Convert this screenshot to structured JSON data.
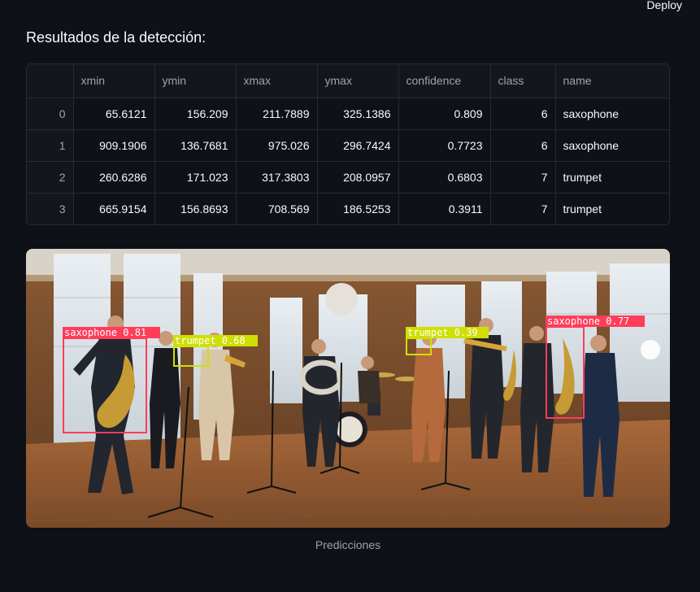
{
  "header": {
    "deploy_label": "Deploy"
  },
  "results": {
    "heading": "Resultados de la detección:",
    "columns": [
      "",
      "xmin",
      "ymin",
      "xmax",
      "ymax",
      "confidence",
      "class",
      "name"
    ],
    "rows": [
      [
        "0",
        "65.6121",
        "156.209",
        "211.7889",
        "325.1386",
        "0.809",
        "6",
        "saxophone"
      ],
      [
        "1",
        "909.1906",
        "136.7681",
        "975.026",
        "296.7424",
        "0.7723",
        "6",
        "saxophone"
      ],
      [
        "2",
        "260.6286",
        "171.023",
        "317.3803",
        "208.0957",
        "0.6803",
        "7",
        "trumpet"
      ],
      [
        "3",
        "665.9154",
        "156.8693",
        "708.569",
        "186.5253",
        "0.3911",
        "7",
        "trumpet"
      ]
    ]
  },
  "image": {
    "caption": "Predicciones",
    "detections": [
      {
        "label": "saxophone 0.81",
        "color": "#ff3d5a"
      },
      {
        "label": "trumpet 0.68",
        "color": "#cfe000"
      },
      {
        "label": "trumpet 0.39",
        "color": "#cfe000"
      },
      {
        "label": "saxophone 0.77",
        "color": "#ff3d5a"
      }
    ]
  },
  "colors": {
    "background": "#0e1117",
    "border": "#262a33",
    "muted_text": "#9fa3ad",
    "saxophone_box": "#ff3d5a",
    "trumpet_box": "#cfe000"
  }
}
